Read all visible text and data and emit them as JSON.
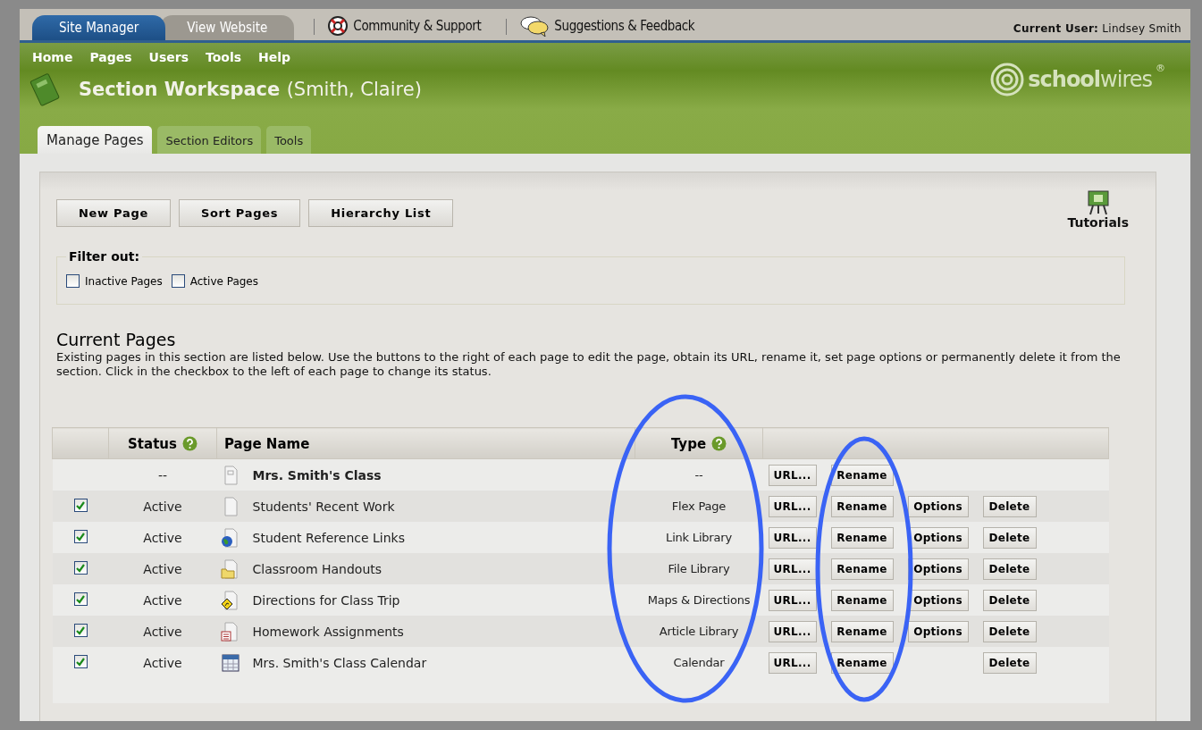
{
  "top_tabs": [
    {
      "label": "Site Manager",
      "selected": true
    },
    {
      "label": "View Website",
      "selected": false
    }
  ],
  "top_links": [
    {
      "label": "Community & Support"
    },
    {
      "label": "Suggestions & Feedback"
    }
  ],
  "current_user": {
    "label": "Current User:",
    "name": "Lindsey Smith"
  },
  "menu": [
    "Home",
    "Pages",
    "Users",
    "Tools",
    "Help"
  ],
  "logo": {
    "bold": "school",
    "light": "wires",
    "mark": "®"
  },
  "title": {
    "main": "Section Workspace",
    "sub": "(Smith, Claire)"
  },
  "section_tabs": [
    {
      "label": "Manage Pages",
      "selected": true
    },
    {
      "label": "Section Editors",
      "selected": false
    },
    {
      "label": "Tools",
      "selected": false
    }
  ],
  "actions": [
    "New Page",
    "Sort Pages",
    "Hierarchy List"
  ],
  "tutorials": {
    "label": "Tutorials"
  },
  "filter": {
    "legend": "Filter out:",
    "options": [
      {
        "label": "Inactive Pages",
        "checked": false
      },
      {
        "label": "Active Pages",
        "checked": false
      }
    ]
  },
  "current_pages": {
    "heading": "Current Pages",
    "description": "Existing pages in this section are listed below. Use the buttons to the right of each page to edit the page, obtain its URL, rename it, set page options or permanently delete it from the section. Click in the checkbox to the left of each page to change its status."
  },
  "table": {
    "columns": [
      {
        "label": "Status",
        "help": true
      },
      {
        "label": "Page Name",
        "help": false
      },
      {
        "label": "Type",
        "help": true
      }
    ],
    "rows": [
      {
        "kind": "section",
        "status": "--",
        "name": "Mrs. Smith's Class",
        "type": "--",
        "buttons": [
          {
            "kind": "url",
            "label": "URL..."
          },
          {
            "kind": "rename",
            "label": "Rename"
          }
        ]
      },
      {
        "kind": "page",
        "checked": true,
        "status": "Active",
        "name": "Students' Recent Work",
        "type": "Flex Page",
        "buttons": [
          {
            "kind": "url",
            "label": "URL..."
          },
          {
            "kind": "rename",
            "label": "Rename"
          },
          {
            "kind": "options",
            "label": "Options"
          },
          {
            "kind": "delete",
            "label": "Delete"
          }
        ]
      },
      {
        "kind": "page",
        "checked": true,
        "status": "Active",
        "name": "Student Reference Links",
        "type": "Link Library",
        "buttons": [
          {
            "kind": "url",
            "label": "URL..."
          },
          {
            "kind": "rename",
            "label": "Rename"
          },
          {
            "kind": "options",
            "label": "Options"
          },
          {
            "kind": "delete",
            "label": "Delete"
          }
        ]
      },
      {
        "kind": "page",
        "checked": true,
        "status": "Active",
        "name": "Classroom Handouts",
        "type": "File Library",
        "buttons": [
          {
            "kind": "url",
            "label": "URL..."
          },
          {
            "kind": "rename",
            "label": "Rename"
          },
          {
            "kind": "options",
            "label": "Options"
          },
          {
            "kind": "delete",
            "label": "Delete"
          }
        ]
      },
      {
        "kind": "page",
        "checked": true,
        "status": "Active",
        "name": "Directions for Class Trip",
        "type": "Maps & Directions",
        "buttons": [
          {
            "kind": "url",
            "label": "URL..."
          },
          {
            "kind": "rename",
            "label": "Rename"
          },
          {
            "kind": "options",
            "label": "Options"
          },
          {
            "kind": "delete",
            "label": "Delete"
          }
        ]
      },
      {
        "kind": "page",
        "checked": true,
        "status": "Active",
        "name": "Homework Assignments",
        "type": "Article Library",
        "buttons": [
          {
            "kind": "url",
            "label": "URL..."
          },
          {
            "kind": "rename",
            "label": "Rename"
          },
          {
            "kind": "options",
            "label": "Options"
          },
          {
            "kind": "delete",
            "label": "Delete"
          }
        ]
      },
      {
        "kind": "page",
        "checked": true,
        "status": "Active",
        "name": "Mrs. Smith's Class Calendar",
        "type": "Calendar",
        "buttons": [
          {
            "kind": "url",
            "label": "URL..."
          },
          {
            "kind": "rename",
            "label": "Rename"
          },
          {
            "kind": "delete",
            "label": "Delete"
          }
        ]
      }
    ]
  }
}
